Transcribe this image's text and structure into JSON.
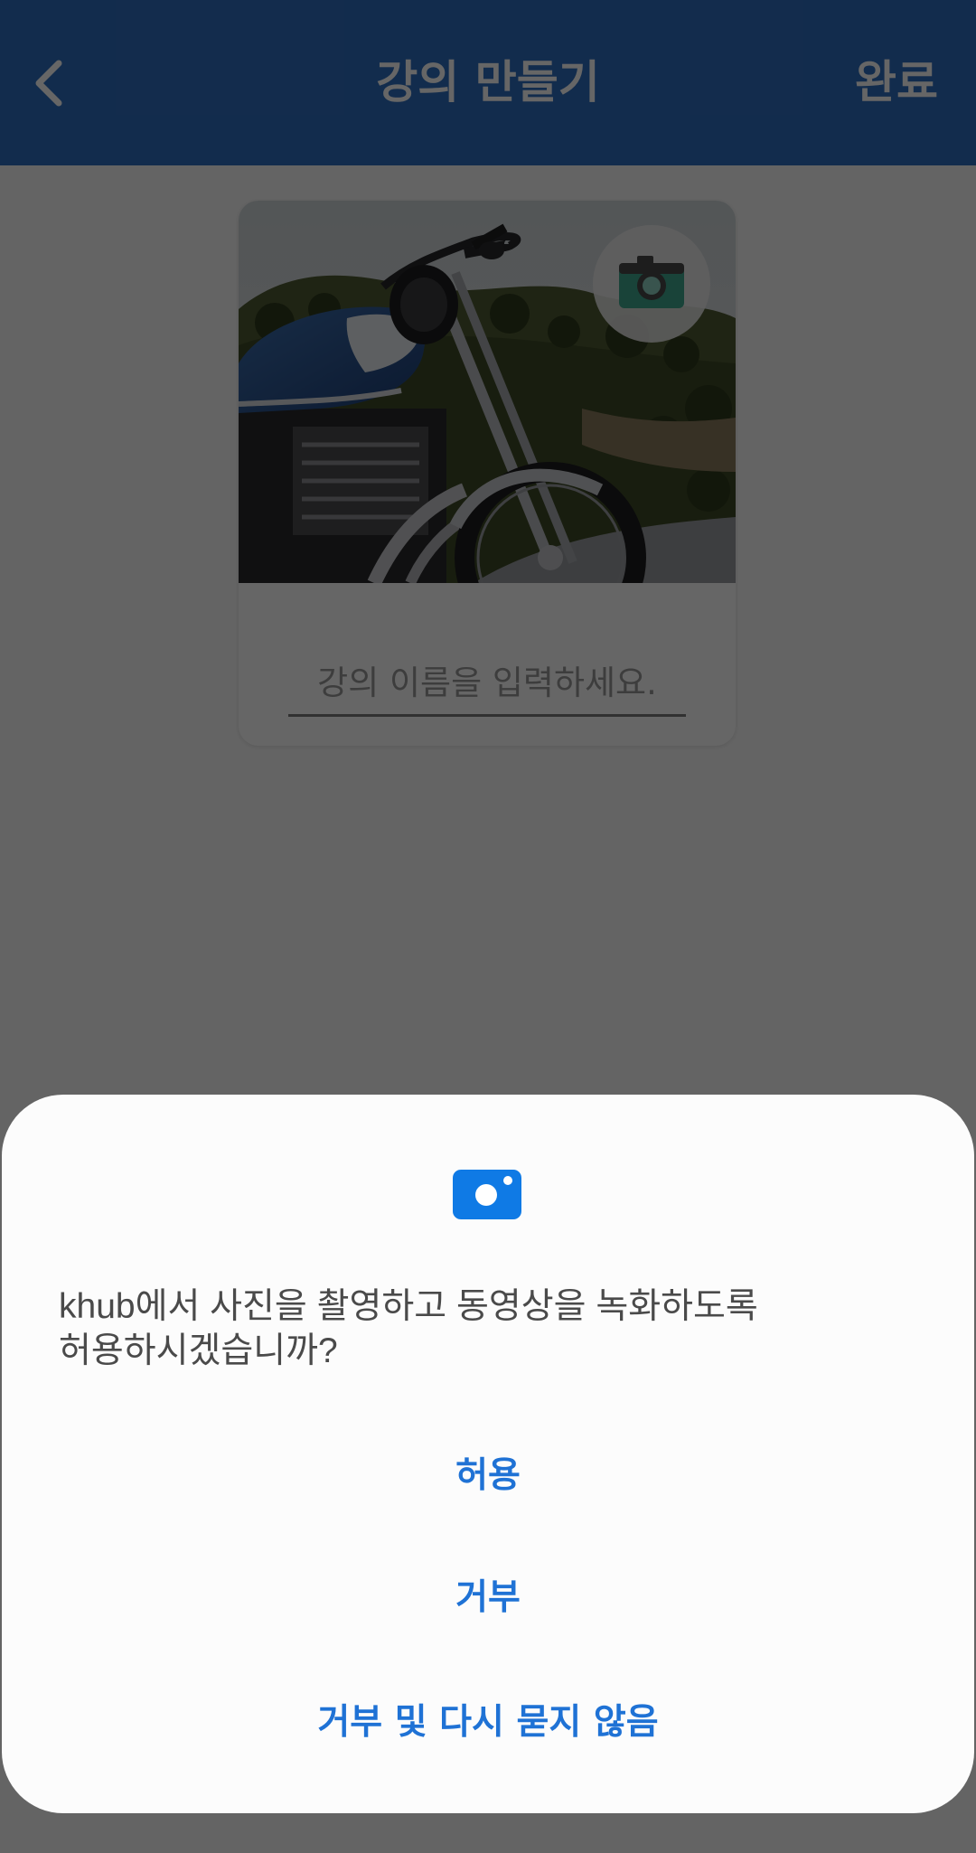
{
  "header": {
    "title": "강의 만들기",
    "done_label": "완료",
    "back_icon": "chevron-left-icon"
  },
  "lecture_card": {
    "cover_image": "motorcycle-photo",
    "camera_icon": "camera-icon",
    "name_input": {
      "value": "",
      "placeholder": "강의 이름을 입력하세요."
    }
  },
  "permission_dialog": {
    "icon": "camera-icon",
    "message_line1": "khub에서 사진을 촬영하고 동영상을 녹화하도록",
    "message_line2": "허용하시겠습니까?",
    "allow_label": "허용",
    "deny_label": "거부",
    "deny_forever_label": "거부 및 다시 묻지 않음"
  },
  "colors": {
    "header_bg": "#2f6fc0",
    "dialog_button_text": "#1f72d5",
    "dialog_bg": "#fcfcfc",
    "scrim": "rgba(0,0,0,0.60)"
  }
}
